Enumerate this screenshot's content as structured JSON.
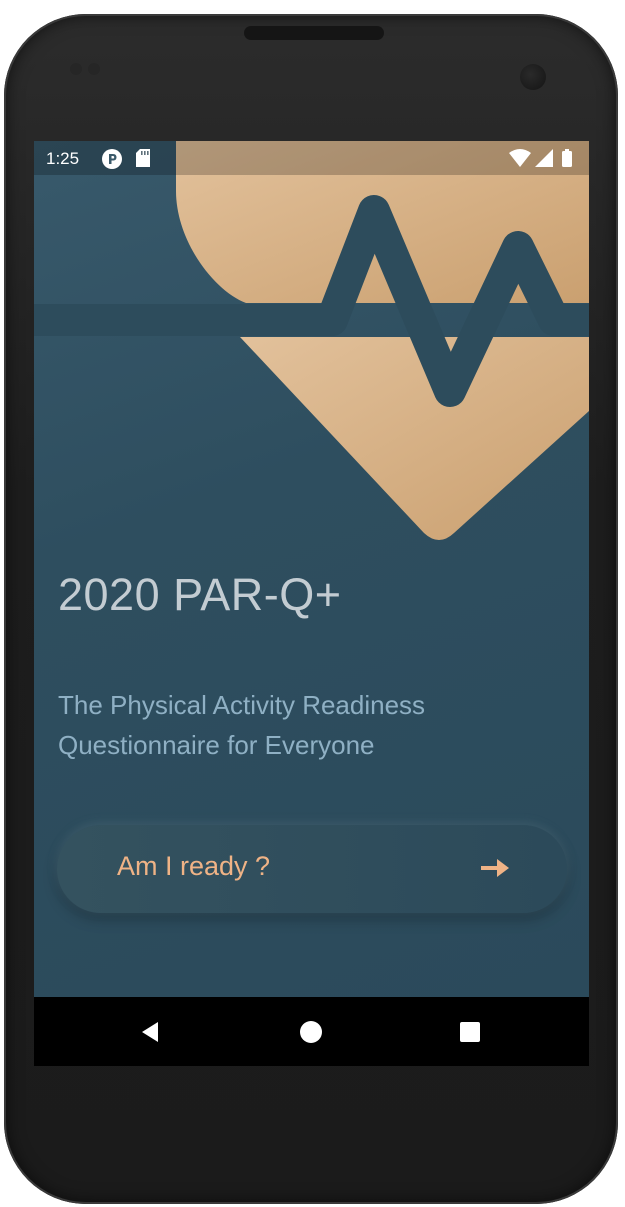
{
  "status_bar": {
    "time": "1:25",
    "icons": [
      "p-notification-icon",
      "sd-card-icon",
      "wifi-icon",
      "cell-signal-icon",
      "battery-icon"
    ]
  },
  "hero": {
    "icon": "heart-pulse-icon",
    "colors": {
      "heart": "#d8ab7f",
      "pulse_line": "#2d4c5c"
    }
  },
  "main": {
    "title": "2020 PAR-Q+",
    "subtitle": "The Physical Activity Readiness Questionnaire for Everyone",
    "cta_label": "Am I ready ?",
    "cta_icon": "arrow-right-icon"
  },
  "nav_bar": {
    "buttons": [
      "back-icon",
      "home-icon",
      "recent-apps-icon"
    ]
  },
  "colors": {
    "background": "#2d4d5e",
    "title_text": "#c3ccd2",
    "subtitle_text": "#8fb0c4",
    "accent": "#efb386"
  }
}
